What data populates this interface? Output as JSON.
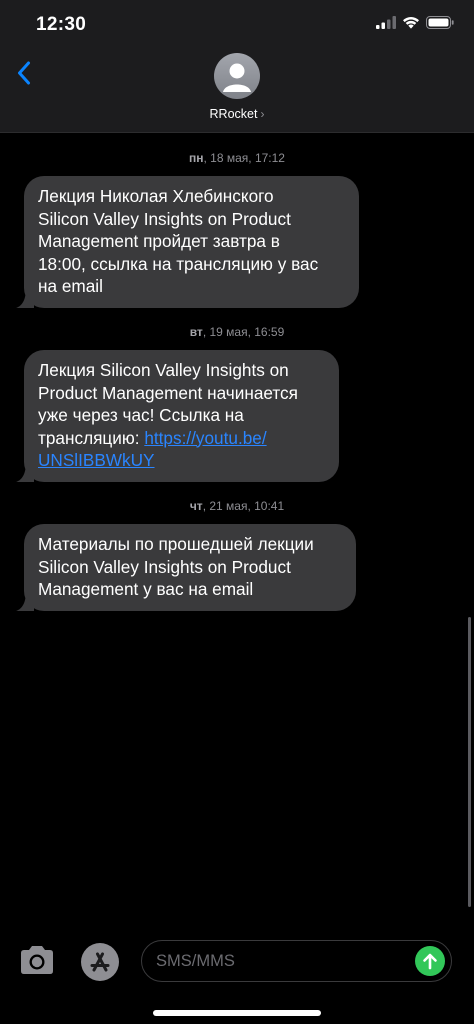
{
  "status_bar": {
    "time": "12:30"
  },
  "header": {
    "contact_name": "RRocket",
    "chevron": "›"
  },
  "messages": [
    {
      "day": "пн",
      "date_time": ", 18 мая, 17:12",
      "lines": [
        "Лекция Николая Хлебинского",
        "Silicon Valley Insights on Product",
        "Management пройдет завтра в",
        "18:00, ссылка на трансляцию у вас",
        "на email"
      ]
    },
    {
      "day": "вт",
      "date_time": ", 19 мая, 16:59",
      "lines": [
        "Лекция Silicon Valley Insights on",
        "Product Management начинается",
        "уже через час! Ссылка на"
      ],
      "link_prefix": "трансляцию: ",
      "link_part1": "https://youtu.be/",
      "link_part2": "UNSlIBBWkUY"
    },
    {
      "day": "чт",
      "date_time": ", 21 мая, 10:41",
      "lines": [
        "Материалы по прошедшей лекции",
        "Silicon Valley Insights on Product",
        "Management у вас на email"
      ]
    }
  ],
  "composer": {
    "placeholder": "SMS/MMS"
  },
  "icons": {
    "back": "chevron-left-icon",
    "avatar": "person-icon",
    "camera": "camera-icon",
    "app_store": "app-store-icon",
    "send": "arrow-up-icon",
    "signal": "cellular-signal-icon",
    "wifi": "wifi-icon",
    "battery": "battery-icon"
  },
  "colors": {
    "accent": "#0a84ff",
    "bubble": "#3a3a3c",
    "send": "#32c759",
    "link": "#2a85ff"
  }
}
